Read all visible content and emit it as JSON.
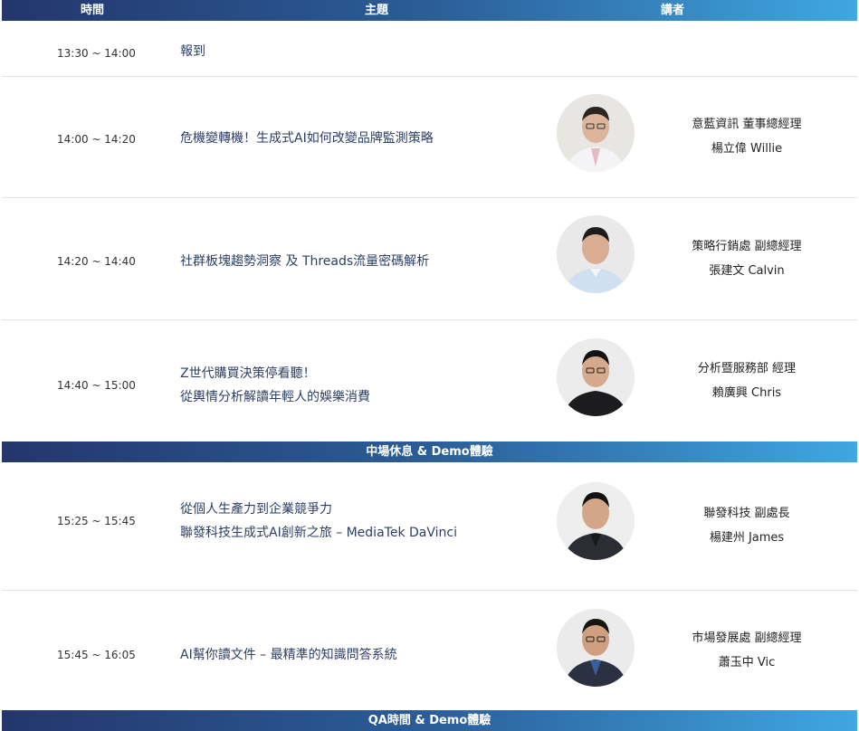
{
  "header": {
    "col_time": "時間",
    "col_topic": "主題",
    "col_speaker": "講者"
  },
  "sessions": [
    {
      "time": "13:30 ~ 14:00",
      "topic": [
        "報到"
      ]
    },
    {
      "time": "14:00 ~ 14:20",
      "topic": [
        "危機變轉機！生成式AI如何改變品牌監測策略"
      ],
      "speaker": {
        "title": "意藍資訊 董事總經理",
        "name": "楊立偉 Willie"
      }
    },
    {
      "time": "14:20 ~ 14:40",
      "topic": [
        "社群板塊趨勢洞察 及 Threads流量密碼解析"
      ],
      "speaker": {
        "title": "策略行銷處 副總經理",
        "name": "張建文 Calvin"
      }
    },
    {
      "time": "14:40 ~ 15:00",
      "topic": [
        "Z世代購買決策停看聽！",
        "從輿情分析解讀年輕人的娛樂消費"
      ],
      "speaker": {
        "title": "分析暨服務部 經理",
        "name": "賴廣興 Chris"
      }
    },
    {
      "time": "15:25 ~ 15:45",
      "topic": [
        "從個人生產力到企業競爭力",
        "聯發科技生成式AI創新之旅 – MediaTek DaVinci"
      ],
      "speaker": {
        "title": "聯發科技 副處長",
        "name": "楊建州 James"
      }
    },
    {
      "time": "15:45 ~ 16:05",
      "topic": [
        "AI幫你讀文件 – 最精準的知識問答系統"
      ],
      "speaker": {
        "title": "市場發展處 副總經理",
        "name": "蕭玉中 Vic"
      }
    }
  ],
  "breaks": {
    "intermission": "中場休息 & Demo體驗",
    "qa": "QA時間 & Demo體驗"
  },
  "colors": {
    "bar_start": "#24366c",
    "bar_end": "#3fa7e1",
    "topic_text": "#2c3e66"
  }
}
